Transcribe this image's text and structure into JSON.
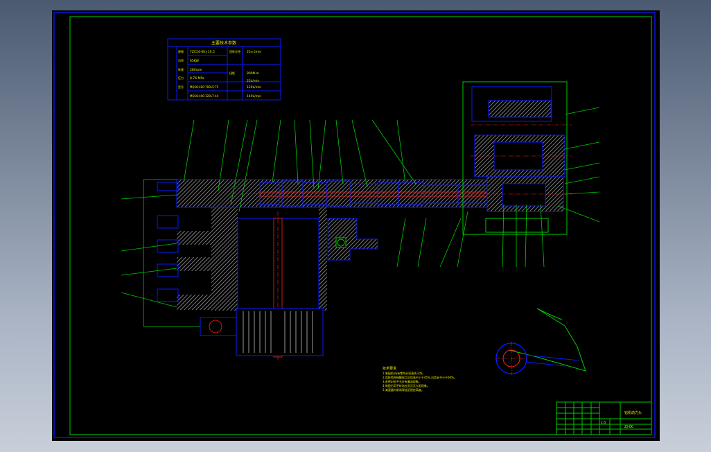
{
  "drawing": {
    "params_table_title": "主要技术参数",
    "params_rows": [
      {
        "c1": "规格",
        "c2": "YZC54-60×10.5",
        "c3": "回转半径",
        "c4": "25±1mm"
      },
      {
        "c1": "功率",
        "c2": "65KW",
        "c3": "",
        "c4": ""
      },
      {
        "c1": "转速",
        "c2": "280rpm",
        "c3": "扭矩",
        "c4": "800N·m"
      },
      {
        "c1": "压力",
        "c2": "8.76 MPa",
        "c3": "",
        "c4": "120L/min"
      },
      {
        "c1": "型号",
        "c2": "MQ18-400-700L5-75",
        "c3": "",
        "c4": "25L/min"
      },
      {
        "c1": "",
        "c2": "MQ18-400-320L7-44",
        "c3": "",
        "c4": "140L/min"
      }
    ],
    "notes_title": "技术要求",
    "notes_lines": [
      "1.装配前,所有零件必须清洗干净。",
      "2.齿轮啮合接触斑点沿齿高不小于45%,沿齿长不小于60%。",
      "3.各密封处不允许有漏油现象。",
      "4.装配后用手转动应灵活无卡阻现象。",
      "5.减速器内装润滑油至规定高度。"
    ],
    "title_block": {
      "drawing_title": "钻机动力头",
      "drawing_no": "ZJ-00",
      "scale": "1:5"
    }
  }
}
